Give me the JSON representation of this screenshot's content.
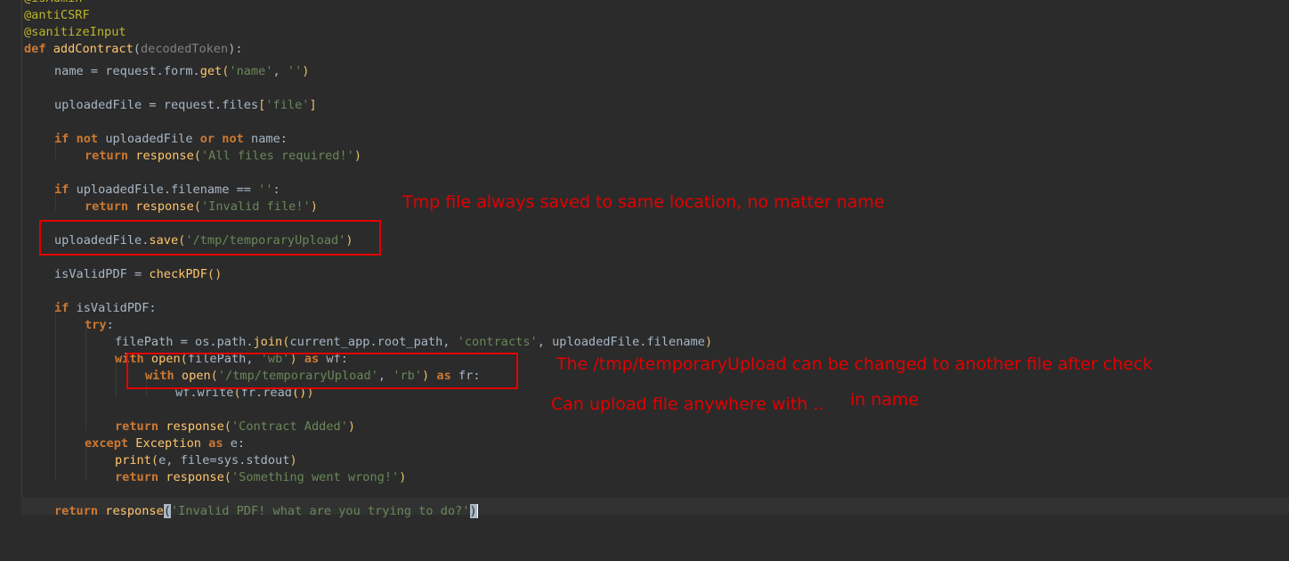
{
  "code": {
    "lines": [
      {
        "indent": 0,
        "tokens": [
          {
            "t": "@isAdmin",
            "c": "dec"
          }
        ]
      },
      {
        "indent": 0,
        "tokens": [
          {
            "t": "@antiCSRF",
            "c": "dec"
          }
        ]
      },
      {
        "indent": 0,
        "tokens": [
          {
            "t": "@sanitizeInput",
            "c": "dec"
          }
        ]
      },
      {
        "indent": 0,
        "tokens": [
          {
            "t": "def ",
            "c": "kw"
          },
          {
            "t": "addContract",
            "c": "fn"
          },
          {
            "t": "(",
            "c": "plain"
          },
          {
            "t": "decodedToken",
            "c": "param"
          },
          {
            "t": "):",
            "c": "plain"
          }
        ]
      },
      {
        "indent": 1,
        "tokens": [
          {
            "t": "name = request.form.",
            "c": "plain"
          },
          {
            "t": "get",
            "c": "fn"
          },
          {
            "t": "(",
            "c": "paren"
          },
          {
            "t": "'name'",
            "c": "str"
          },
          {
            "t": ", ",
            "c": "plain"
          },
          {
            "t": "''",
            "c": "str"
          },
          {
            "t": ")",
            "c": "paren"
          }
        ]
      },
      {
        "indent": 1,
        "tokens": []
      },
      {
        "indent": 1,
        "tokens": [
          {
            "t": "uploadedFile = request.files",
            "c": "plain"
          },
          {
            "t": "[",
            "c": "paren"
          },
          {
            "t": "'file'",
            "c": "str"
          },
          {
            "t": "]",
            "c": "paren"
          }
        ]
      },
      {
        "indent": 1,
        "tokens": []
      },
      {
        "indent": 1,
        "tokens": [
          {
            "t": "if ",
            "c": "kw"
          },
          {
            "t": "not ",
            "c": "kw"
          },
          {
            "t": "uploadedFile ",
            "c": "plain"
          },
          {
            "t": "or ",
            "c": "kw"
          },
          {
            "t": "not ",
            "c": "kw"
          },
          {
            "t": "name:",
            "c": "plain"
          }
        ]
      },
      {
        "indent": 2,
        "tokens": [
          {
            "t": "return ",
            "c": "kw"
          },
          {
            "t": "response",
            "c": "fn"
          },
          {
            "t": "(",
            "c": "paren"
          },
          {
            "t": "'All files required!'",
            "c": "str"
          },
          {
            "t": ")",
            "c": "paren"
          }
        ]
      },
      {
        "indent": 1,
        "tokens": []
      },
      {
        "indent": 1,
        "tokens": [
          {
            "t": "if ",
            "c": "kw"
          },
          {
            "t": "uploadedFile.filename == ",
            "c": "plain"
          },
          {
            "t": "''",
            "c": "str"
          },
          {
            "t": ":",
            "c": "plain"
          }
        ]
      },
      {
        "indent": 2,
        "tokens": [
          {
            "t": "return ",
            "c": "kw"
          },
          {
            "t": "response",
            "c": "fn"
          },
          {
            "t": "(",
            "c": "paren"
          },
          {
            "t": "'Invalid file!'",
            "c": "str"
          },
          {
            "t": ")",
            "c": "paren"
          }
        ]
      },
      {
        "indent": 1,
        "tokens": []
      },
      {
        "indent": 1,
        "tokens": [
          {
            "t": "uploadedFile.",
            "c": "plain"
          },
          {
            "t": "save",
            "c": "fn"
          },
          {
            "t": "(",
            "c": "paren"
          },
          {
            "t": "'/tmp/temporaryUpload'",
            "c": "str"
          },
          {
            "t": ")",
            "c": "paren"
          }
        ]
      },
      {
        "indent": 1,
        "tokens": []
      },
      {
        "indent": 1,
        "tokens": [
          {
            "t": "isValidPDF = ",
            "c": "plain"
          },
          {
            "t": "checkPDF",
            "c": "fn"
          },
          {
            "t": "()",
            "c": "paren"
          }
        ]
      },
      {
        "indent": 1,
        "tokens": []
      },
      {
        "indent": 1,
        "tokens": [
          {
            "t": "if ",
            "c": "kw"
          },
          {
            "t": "isValidPDF:",
            "c": "plain"
          }
        ]
      },
      {
        "indent": 2,
        "tokens": [
          {
            "t": "try",
            "c": "kw"
          },
          {
            "t": ":",
            "c": "plain"
          }
        ]
      },
      {
        "indent": 3,
        "tokens": [
          {
            "t": "filePath = os.path.",
            "c": "plain"
          },
          {
            "t": "join",
            "c": "fn"
          },
          {
            "t": "(",
            "c": "paren"
          },
          {
            "t": "current_app.root_path, ",
            "c": "plain"
          },
          {
            "t": "'contracts'",
            "c": "str"
          },
          {
            "t": ", uploadedFile.filename",
            "c": "plain"
          },
          {
            "t": ")",
            "c": "paren"
          }
        ]
      },
      {
        "indent": 3,
        "tokens": [
          {
            "t": "with ",
            "c": "kw"
          },
          {
            "t": "open",
            "c": "fn"
          },
          {
            "t": "(",
            "c": "paren"
          },
          {
            "t": "filePath, ",
            "c": "plain"
          },
          {
            "t": "'wb'",
            "c": "str"
          },
          {
            "t": ") ",
            "c": "paren"
          },
          {
            "t": "as ",
            "c": "kw"
          },
          {
            "t": "wf:",
            "c": "plain"
          }
        ]
      },
      {
        "indent": 4,
        "tokens": [
          {
            "t": "with ",
            "c": "kw"
          },
          {
            "t": "open",
            "c": "fn"
          },
          {
            "t": "(",
            "c": "paren"
          },
          {
            "t": "'/tmp/temporaryUpload'",
            "c": "str"
          },
          {
            "t": ", ",
            "c": "plain"
          },
          {
            "t": "'rb'",
            "c": "str"
          },
          {
            "t": ") ",
            "c": "paren"
          },
          {
            "t": "as ",
            "c": "kw"
          },
          {
            "t": "fr:",
            "c": "plain"
          }
        ]
      },
      {
        "indent": 5,
        "tokens": [
          {
            "t": "wf.write",
            "c": "plain"
          },
          {
            "t": "(",
            "c": "paren"
          },
          {
            "t": "fr.read",
            "c": "plain"
          },
          {
            "t": "()",
            "c": "fn"
          },
          {
            "t": ")",
            "c": "paren"
          }
        ]
      },
      {
        "indent": 3,
        "tokens": []
      },
      {
        "indent": 3,
        "tokens": [
          {
            "t": "return ",
            "c": "kw"
          },
          {
            "t": "response",
            "c": "fn"
          },
          {
            "t": "(",
            "c": "paren"
          },
          {
            "t": "'Contract Added'",
            "c": "str"
          },
          {
            "t": ")",
            "c": "paren"
          }
        ]
      },
      {
        "indent": 2,
        "tokens": [
          {
            "t": "except ",
            "c": "kw"
          },
          {
            "t": "Exception ",
            "c": "fn"
          },
          {
            "t": "as ",
            "c": "kw"
          },
          {
            "t": "e:",
            "c": "plain"
          }
        ]
      },
      {
        "indent": 3,
        "tokens": [
          {
            "t": "print",
            "c": "fn"
          },
          {
            "t": "(",
            "c": "paren"
          },
          {
            "t": "e, file=sys.stdout",
            "c": "plain"
          },
          {
            "t": ")",
            "c": "paren"
          }
        ]
      },
      {
        "indent": 3,
        "tokens": [
          {
            "t": "return ",
            "c": "kw"
          },
          {
            "t": "response",
            "c": "fn"
          },
          {
            "t": "(",
            "c": "paren"
          },
          {
            "t": "'Something went wrong!'",
            "c": "str"
          },
          {
            "t": ")",
            "c": "paren"
          }
        ]
      },
      {
        "indent": 0,
        "tokens": []
      },
      {
        "indent": 1,
        "current": true,
        "tokens": [
          {
            "t": "return ",
            "c": "kw"
          },
          {
            "t": "response",
            "c": "fn"
          },
          {
            "t": "(",
            "c": "caret-paren"
          },
          {
            "t": "'Invalid PDF! what are you trying to do?'",
            "c": "str"
          },
          {
            "t": ")",
            "c": "caret-paren"
          }
        ]
      }
    ]
  },
  "annotations": {
    "tmp_file_note": "Tmp file always saved to same location, no matter name",
    "race_note": "The /tmp/temporaryUpload can be changed to another file after check",
    "traversal_note_a": "Can upload file anywhere with ..",
    "traversal_note_b": "in name"
  },
  "colors": {
    "background": "#2b2b2b",
    "keyword": "#cc7832",
    "string": "#6a8759",
    "function": "#ffc66d",
    "decorator": "#bbb529",
    "annotation_red": "#e30000"
  }
}
